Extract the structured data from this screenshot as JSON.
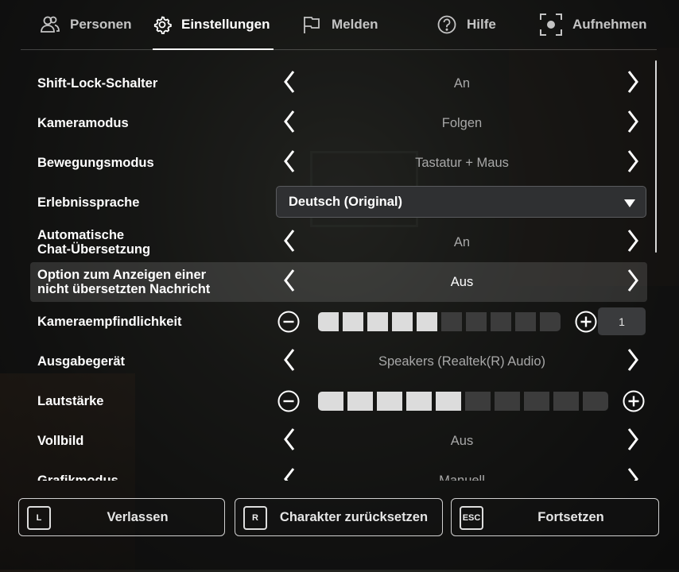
{
  "tabs": [
    {
      "label": "Personen",
      "icon": "people-icon"
    },
    {
      "label": "Einstellungen",
      "icon": "gear-icon",
      "active": true
    },
    {
      "label": "Melden",
      "icon": "flag-icon"
    },
    {
      "label": "Hilfe",
      "icon": "help-icon"
    },
    {
      "label": "Aufnehmen",
      "icon": "record-icon"
    }
  ],
  "settings": {
    "shift_lock": {
      "label": "Shift-Lock-Schalter",
      "value": "An"
    },
    "camera_mode": {
      "label": "Kameramodus",
      "value": "Folgen"
    },
    "movement_mode": {
      "label": "Bewegungsmodus",
      "value": "Tastatur + Maus"
    },
    "experience_language": {
      "label": "Erlebnissprache",
      "value": "Deutsch (Original)"
    },
    "auto_chat_translation": {
      "label": "Automatische\nChat-Übersetzung",
      "value": "An"
    },
    "show_untranslated": {
      "label": "Option zum Anzeigen einer\nnicht übersetzten Nachricht",
      "value": "Aus"
    },
    "camera_sensitivity": {
      "label": "Kameraempfindlichkeit",
      "value": "1",
      "filled": 5,
      "total": 10
    },
    "output_device": {
      "label": "Ausgabegerät",
      "value": "Speakers (Realtek(R) Audio)"
    },
    "volume": {
      "label": "Lautstärke",
      "filled": 5,
      "total": 10
    },
    "fullscreen": {
      "label": "Vollbild",
      "value": "Aus"
    },
    "graphics_mode": {
      "label": "Grafikmodus",
      "value": "Manuell"
    }
  },
  "footer": {
    "leave": {
      "key": "L",
      "label": "Verlassen"
    },
    "reset": {
      "key": "R",
      "label": "Charakter zurücksetzen"
    },
    "resume": {
      "key": "ESC",
      "label": "Fortsetzen"
    }
  },
  "colors": {
    "segment_on": "#dcdcdc",
    "segment_off": "#3c3c3c",
    "highlight_row": "#3a3a3a"
  }
}
